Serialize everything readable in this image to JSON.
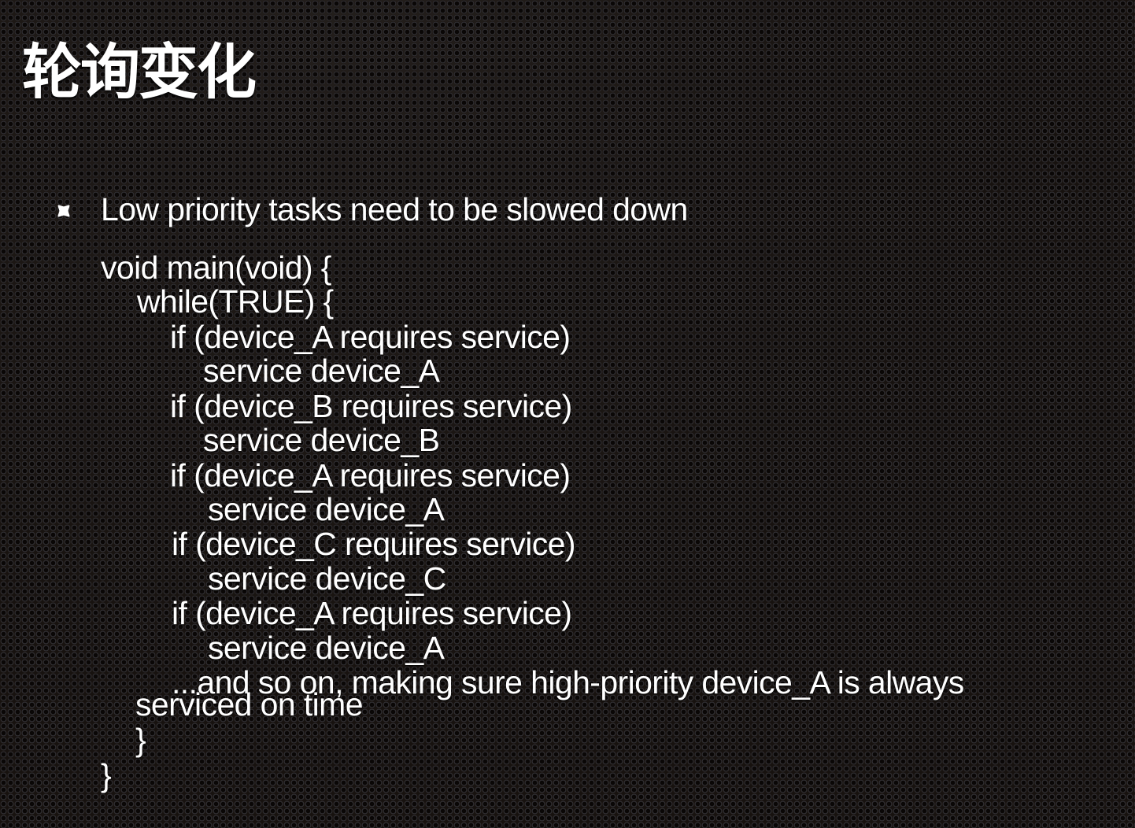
{
  "title": "轮询变化",
  "bullet": "Low priority tasks need to be slowed down",
  "code": [
    "void main(void) {",
    "while(TRUE) {",
    "if (device_A requires service)",
    "service device_A",
    "if (device_B requires service)",
    "service device_B",
    "if (device_A requires service)",
    "service device_A",
    "if (device_C requires service)",
    "service device_C",
    "if (device_A requires service)",
    "service device_A",
    "...and so on, making sure high-priority device_A is always",
    "serviced on time",
    "}",
    "}"
  ]
}
